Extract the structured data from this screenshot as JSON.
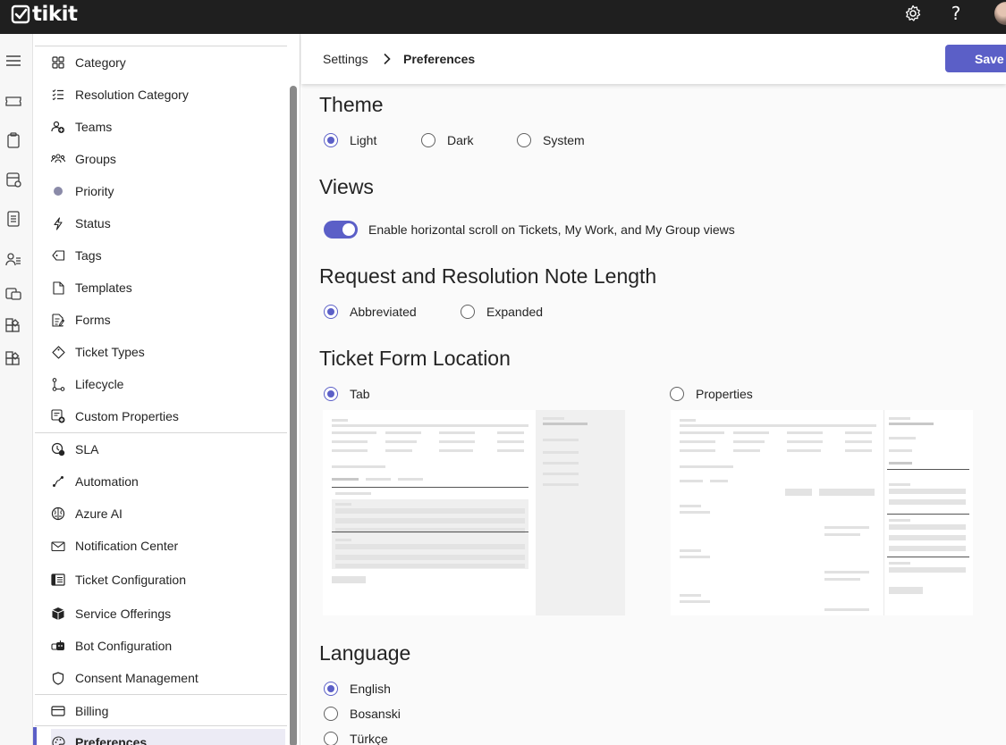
{
  "app": {
    "name": "tikit"
  },
  "header": {
    "help_label": "?"
  },
  "breadcrumb": {
    "parent": "Settings",
    "current": "Preferences"
  },
  "toolbar": {
    "save_label": "Save"
  },
  "nav": {
    "items": [
      {
        "label": "Category",
        "icon": "category-grid-icon"
      },
      {
        "label": "Resolution Category",
        "icon": "checklist-icon"
      },
      {
        "label": "Teams",
        "icon": "teams-icon"
      },
      {
        "label": "Groups",
        "icon": "groups-icon"
      },
      {
        "label": "Priority",
        "icon": "priority-dot-icon"
      },
      {
        "label": "Status",
        "icon": "lightning-icon"
      },
      {
        "label": "Tags",
        "icon": "tag-icon"
      },
      {
        "label": "Templates",
        "icon": "document-icon"
      },
      {
        "label": "Forms",
        "icon": "form-icon"
      },
      {
        "label": "Ticket Types",
        "icon": "ticket-type-icon"
      },
      {
        "label": "Lifecycle",
        "icon": "lifecycle-icon"
      },
      {
        "label": "Custom Properties",
        "icon": "custom-properties-icon"
      },
      {
        "label": "SLA",
        "icon": "sla-icon"
      },
      {
        "label": "Automation",
        "icon": "automation-icon"
      },
      {
        "label": "Azure AI",
        "icon": "brain-icon"
      },
      {
        "label": "Notification Center",
        "icon": "mail-icon"
      },
      {
        "label": "Ticket Configuration",
        "icon": "ticket-config-icon"
      },
      {
        "label": "Service Offerings",
        "icon": "box-icon"
      },
      {
        "label": "Bot Configuration",
        "icon": "bot-icon"
      },
      {
        "label": "Consent Management",
        "icon": "shield-icon"
      },
      {
        "label": "Billing",
        "icon": "billing-icon"
      },
      {
        "label": "Preferences",
        "icon": "palette-icon",
        "active": true
      }
    ]
  },
  "sections": {
    "theme": {
      "title": "Theme",
      "options": [
        "Light",
        "Dark",
        "System"
      ],
      "selected": "Light"
    },
    "views": {
      "title": "Views",
      "toggle_label": "Enable horizontal scroll on Tickets, My Work, and My Group views",
      "toggle_on": true
    },
    "note_length": {
      "title": "Request and Resolution Note Length",
      "options": [
        "Abbreviated",
        "Expanded"
      ],
      "selected": "Abbreviated"
    },
    "form_location": {
      "title": "Ticket Form Location",
      "options": [
        "Tab",
        "Properties"
      ],
      "selected": "Tab"
    },
    "language": {
      "title": "Language",
      "options": [
        "English",
        "Bosanski",
        "Türkçe"
      ],
      "selected": "English"
    }
  },
  "colors": {
    "accent": "#5b5fc7",
    "topbar": "#1f1f1f"
  }
}
